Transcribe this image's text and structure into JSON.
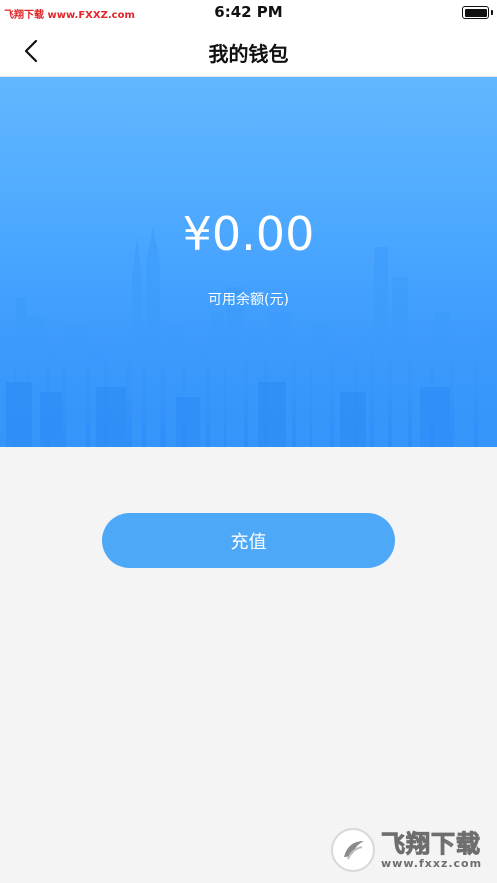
{
  "status_bar": {
    "watermark": "飞翔下载 www.FXXZ.com",
    "time": "6:42 PM"
  },
  "nav": {
    "title": "我的钱包"
  },
  "wallet": {
    "balance": "¥0.00",
    "balance_label": "可用余额(元)"
  },
  "actions": {
    "recharge_label": "充值"
  },
  "watermark": {
    "brand_name": "飞翔下载",
    "brand_url": "www.fxxz.com"
  },
  "colors": {
    "accent": "#4ea8f8",
    "panel_top": "#62b8ff",
    "panel_bottom": "#2f8ef9",
    "background": "#f4f4f4"
  },
  "icons": {
    "back": "chevron-left-icon",
    "battery": "battery-icon"
  }
}
